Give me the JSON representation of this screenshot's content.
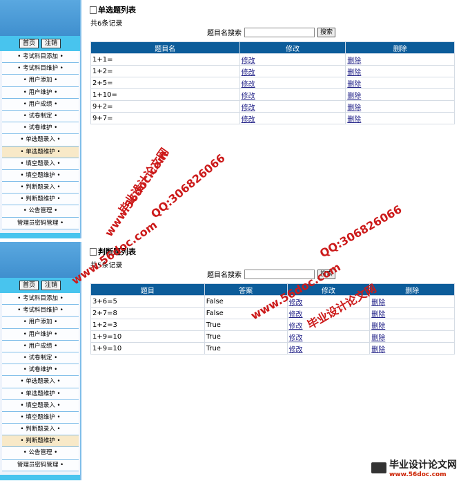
{
  "sidebar": {
    "home_label": "首页",
    "logout_label": "注销"
  },
  "panel_top": {
    "title": "单选题列表",
    "count": "共6条记录",
    "search_label": "题目名搜索",
    "search_button": "搜索",
    "menu": [
      "• 考试科目添加 •",
      "• 考试科目维护 •",
      "• 用户添加 •",
      "• 用户维护 •",
      "• 用户成绩 •",
      "• 试卷制定 •",
      "• 试卷维护 •",
      "• 单选题录入 •",
      "• 单选题维护 •",
      "• 填空题录入 •",
      "• 填空题维护 •",
      "• 判断题录入 •",
      "• 判断题维护 •",
      "• 公告管理 •",
      "管理员密码管理 •"
    ],
    "headers": [
      "题目名",
      "修改",
      "删除"
    ],
    "rows": [
      {
        "q": "1+1=",
        "edit": "修改",
        "del": "删除"
      },
      {
        "q": "1+2=",
        "edit": "修改",
        "del": "删除"
      },
      {
        "q": "2+5=",
        "edit": "修改",
        "del": "删除"
      },
      {
        "q": "1+10=",
        "edit": "修改",
        "del": "删除"
      },
      {
        "q": "9+2=",
        "edit": "修改",
        "del": "删除"
      },
      {
        "q": "9+7=",
        "edit": "修改",
        "del": "删除"
      }
    ]
  },
  "panel_bottom": {
    "title": "判断题列表",
    "count": "共5条记录",
    "search_label": "题目名搜索",
    "search_button": "搜索",
    "menu": [
      "• 考试科目添加 •",
      "• 考试科目维护 •",
      "• 用户添加 •",
      "• 用户维护 •",
      "• 用户成绩 •",
      "• 试卷制定 •",
      "• 试卷维护 •",
      "• 单选题录入 •",
      "• 单选题维护 •",
      "• 填空题录入 •",
      "• 填空题维护 •",
      "• 判断题录入 •",
      "• 判断题维护 •",
      "• 公告管理 •",
      "管理员密码管理 •"
    ],
    "headers": [
      "题目",
      "答案",
      "修改",
      "删除"
    ],
    "rows": [
      {
        "q": "3+6=5",
        "a": "False",
        "edit": "修改",
        "del": "删除"
      },
      {
        "q": "2+7=8",
        "a": "False",
        "edit": "修改",
        "del": "删除"
      },
      {
        "q": "1+2=3",
        "a": "True",
        "edit": "修改",
        "del": "删除"
      },
      {
        "q": "1+9=10",
        "a": "True",
        "edit": "修改",
        "del": "删除"
      },
      {
        "q": "1+9=10",
        "a": "True",
        "edit": "修改",
        "del": "删除"
      }
    ]
  },
  "watermarks": {
    "site_cn": "毕业设计论文网",
    "site_url": "www.56doc.com",
    "qq": "QQ:306826066"
  }
}
